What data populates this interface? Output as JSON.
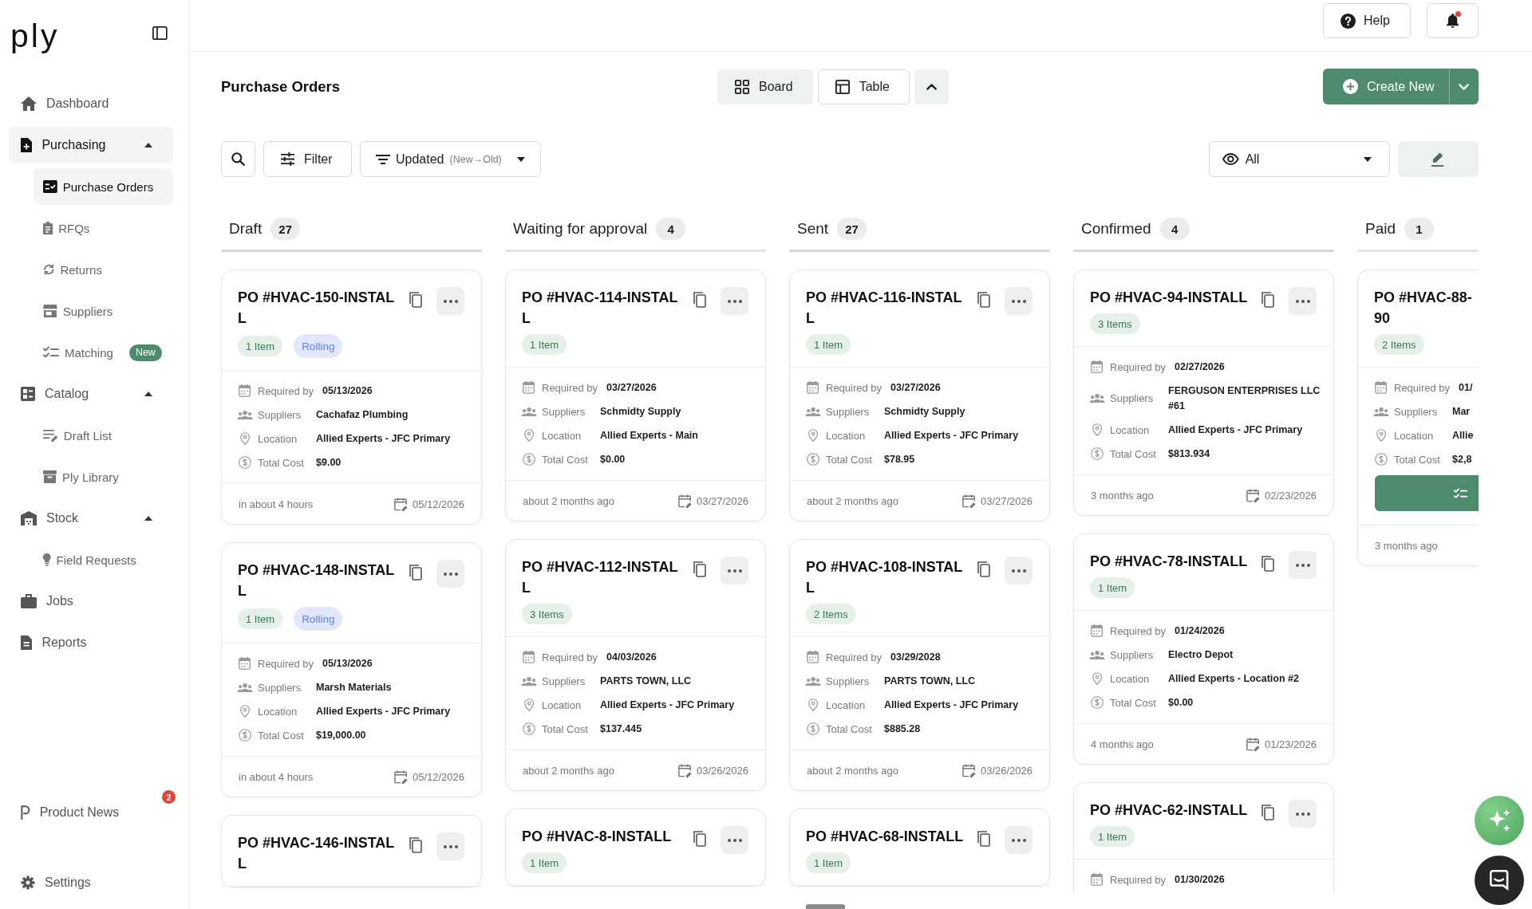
{
  "sidebar": {
    "logo": "ply",
    "items": [
      {
        "label": "Dashboard",
        "selected": false
      },
      {
        "label": "Purchasing",
        "selected": true,
        "expanded": true,
        "children": [
          {
            "label": "Purchase Orders",
            "selected": true
          },
          {
            "label": "RFQs",
            "selected": false
          },
          {
            "label": "Returns",
            "selected": false
          },
          {
            "label": "Suppliers",
            "selected": false
          },
          {
            "label": "Matching",
            "selected": false,
            "badge": {
              "text": "New",
              "kind": "new"
            }
          }
        ]
      },
      {
        "label": "Catalog",
        "selected": false,
        "expanded": true,
        "children": [
          {
            "label": "Draft List",
            "selected": false
          },
          {
            "label": "Ply Library",
            "selected": false
          }
        ]
      },
      {
        "label": "Stock",
        "selected": false,
        "expanded": true,
        "children": [
          {
            "label": "Field Requests",
            "selected": false
          }
        ]
      },
      {
        "label": "Jobs",
        "selected": false
      },
      {
        "label": "Reports",
        "selected": false
      }
    ],
    "footer_items": [
      {
        "label": "Product News",
        "selected": false,
        "badge": {
          "text": "2",
          "kind": "count"
        }
      },
      {
        "label": "Settings",
        "selected": false
      }
    ]
  },
  "topbar": {
    "help": "Help",
    "notifications": {
      "unread": true
    }
  },
  "header": {
    "title": "Purchase Orders",
    "views": [
      {
        "label": "Board",
        "selected": true
      },
      {
        "label": "Table",
        "selected": false
      }
    ],
    "create": "Create New"
  },
  "toolbar": {
    "filter": "Filter",
    "sort": {
      "label": "Updated",
      "order": "(New→Old)"
    },
    "visibility": "All"
  },
  "columns": [
    {
      "title": "Draft",
      "count": "27",
      "color": "#d6d6d6",
      "cards": [
        {
          "title": "PO #HVAC-150-INSTALL",
          "actions": [
            {
              "kind": "copy"
            },
            {
              "kind": "more"
            }
          ],
          "chips": [
            {
              "label": "1 Item",
              "kind": "count"
            },
            {
              "label": "Rolling",
              "kind": "tag"
            }
          ],
          "details": [
            {
              "kind": "required",
              "label": "Required by",
              "value": "05/13/2026"
            },
            {
              "kind": "suppliers",
              "label": "Suppliers",
              "value": "Cachafaz Plumbing"
            },
            {
              "kind": "location",
              "label": "Location",
              "value": "Allied Experts - JFC Primary"
            },
            {
              "kind": "cost",
              "label": "Total Cost",
              "value": "$9.00"
            }
          ],
          "footer": {
            "relative": "in about 4 hours",
            "date": "05/12/2026"
          }
        },
        {
          "title": "PO #HVAC-148-INSTALL",
          "actions": [
            {
              "kind": "copy"
            },
            {
              "kind": "more"
            }
          ],
          "chips": [
            {
              "label": "1 Item",
              "kind": "count"
            },
            {
              "label": "Rolling",
              "kind": "tag"
            }
          ],
          "details": [
            {
              "kind": "required",
              "label": "Required by",
              "value": "05/13/2026"
            },
            {
              "kind": "suppliers",
              "label": "Suppliers",
              "value": "Marsh Materials"
            },
            {
              "kind": "location",
              "label": "Location",
              "value": "Allied Experts - JFC Primary"
            },
            {
              "kind": "cost",
              "label": "Total Cost",
              "value": "$19,000.00"
            }
          ],
          "footer": {
            "relative": "in about 4 hours",
            "date": "05/12/2026"
          }
        },
        {
          "title": "PO #HVAC-146-INSTALL",
          "actions": [
            {
              "kind": "copy"
            },
            {
              "kind": "more"
            }
          ]
        }
      ]
    },
    {
      "title": "Waiting for approval",
      "count": "4",
      "color": "#e2e0f7",
      "cards": [
        {
          "title": "PO #HVAC-114-INSTALL",
          "actions": [
            {
              "kind": "copy"
            },
            {
              "kind": "more"
            }
          ],
          "chips": [
            {
              "label": "1 Item",
              "kind": "count"
            }
          ],
          "details": [
            {
              "kind": "required",
              "label": "Required by",
              "value": "03/27/2026"
            },
            {
              "kind": "suppliers",
              "label": "Suppliers",
              "value": "Schmidty Supply"
            },
            {
              "kind": "location",
              "label": "Location",
              "value": "Allied Experts - Main"
            },
            {
              "kind": "cost",
              "label": "Total Cost",
              "value": "$0.00"
            }
          ],
          "footer": {
            "relative": "about 2 months ago",
            "date": "03/27/2026"
          }
        },
        {
          "title": "PO #HVAC-112-INSTALL",
          "actions": [
            {
              "kind": "copy"
            },
            {
              "kind": "more"
            }
          ],
          "chips": [
            {
              "label": "3 Items",
              "kind": "count"
            }
          ],
          "details": [
            {
              "kind": "required",
              "label": "Required by",
              "value": "04/03/2026"
            },
            {
              "kind": "suppliers",
              "label": "Suppliers",
              "value": "PARTS TOWN, LLC"
            },
            {
              "kind": "location",
              "label": "Location",
              "value": "Allied Experts - JFC Primary"
            },
            {
              "kind": "cost",
              "label": "Total Cost",
              "value": "$137.445"
            }
          ],
          "footer": {
            "relative": "about 2 months ago",
            "date": "03/26/2026"
          }
        },
        {
          "title": "PO #HVAC-8-INSTALL",
          "actions": [
            {
              "kind": "copy"
            },
            {
              "kind": "more"
            }
          ],
          "chips": [
            {
              "label": "1 Item",
              "kind": "count"
            }
          ]
        }
      ]
    },
    {
      "title": "Sent",
      "count": "27",
      "color": "#d6d6d6",
      "cards": [
        {
          "title": "PO #HVAC-116-INSTALL",
          "actions": [
            {
              "kind": "copy"
            },
            {
              "kind": "more"
            }
          ],
          "chips": [
            {
              "label": "1 Item",
              "kind": "count"
            }
          ],
          "details": [
            {
              "kind": "required",
              "label": "Required by",
              "value": "03/27/2026"
            },
            {
              "kind": "suppliers",
              "label": "Suppliers",
              "value": "Schmidty Supply"
            },
            {
              "kind": "location",
              "label": "Location",
              "value": "Allied Experts - JFC Primary"
            },
            {
              "kind": "cost",
              "label": "Total Cost",
              "value": "$78.95"
            }
          ],
          "footer": {
            "relative": "about 2 months ago",
            "date": "03/27/2026"
          }
        },
        {
          "title": "PO #HVAC-108-INSTALL",
          "actions": [
            {
              "kind": "copy"
            },
            {
              "kind": "more"
            }
          ],
          "chips": [
            {
              "label": "2 Items",
              "kind": "count"
            }
          ],
          "details": [
            {
              "kind": "required",
              "label": "Required by",
              "value": "03/29/2028"
            },
            {
              "kind": "suppliers",
              "label": "Suppliers",
              "value": "PARTS TOWN, LLC"
            },
            {
              "kind": "location",
              "label": "Location",
              "value": "Allied Experts - JFC Primary"
            },
            {
              "kind": "cost",
              "label": "Total Cost",
              "value": "$885.28"
            }
          ],
          "footer": {
            "relative": "about 2 months ago",
            "date": "03/26/2026"
          }
        },
        {
          "title": "PO #HVAC-68-INSTALL",
          "actions": [
            {
              "kind": "copy"
            },
            {
              "kind": "more"
            }
          ],
          "chips": [
            {
              "label": "1 Item",
              "kind": "count"
            }
          ]
        }
      ]
    },
    {
      "title": "Confirmed",
      "count": "4",
      "color": "#d6d6d6",
      "cards": [
        {
          "title": "PO #HVAC-94-INSTALL",
          "actions": [
            {
              "kind": "copy"
            },
            {
              "kind": "more"
            }
          ],
          "chips": [
            {
              "label": "3 Items",
              "kind": "count"
            }
          ],
          "details": [
            {
              "kind": "required",
              "label": "Required by",
              "value": "02/27/2026"
            },
            {
              "kind": "suppliers",
              "label": "Suppliers",
              "value": "FERGUSON ENTERPRISES LLC #61"
            },
            {
              "kind": "location",
              "label": "Location",
              "value": "Allied Experts - JFC Primary"
            },
            {
              "kind": "cost",
              "label": "Total Cost",
              "value": "$813.934"
            }
          ],
          "footer": {
            "relative": "3 months ago",
            "date": "02/23/2026"
          }
        },
        {
          "title": "PO #HVAC-78-INSTALL",
          "actions": [
            {
              "kind": "copy"
            },
            {
              "kind": "more"
            }
          ],
          "chips": [
            {
              "label": "1 Item",
              "kind": "count"
            }
          ],
          "details": [
            {
              "kind": "required",
              "label": "Required by",
              "value": "01/24/2026"
            },
            {
              "kind": "suppliers",
              "label": "Suppliers",
              "value": "Electro Depot"
            },
            {
              "kind": "location",
              "label": "Location",
              "value": "Allied Experts - Location #2"
            },
            {
              "kind": "cost",
              "label": "Total Cost",
              "value": "$0.00"
            }
          ],
          "footer": {
            "relative": "4 months ago",
            "date": "01/23/2026"
          }
        },
        {
          "title": "PO #HVAC-62-INSTALL",
          "actions": [
            {
              "kind": "copy"
            },
            {
              "kind": "more"
            }
          ],
          "chips": [
            {
              "label": "1 Item",
              "kind": "count"
            }
          ],
          "details": [
            {
              "kind": "required",
              "label": "Required by",
              "value": "01/30/2026"
            }
          ]
        }
      ]
    },
    {
      "title": "Paid",
      "count": "1",
      "color": "#e2e0f7",
      "cards": [
        {
          "title": "PO #HVAC-88-\n90",
          "chips": [
            {
              "label": "2 Items",
              "kind": "count"
            }
          ],
          "details": [
            {
              "kind": "required",
              "label": "Required by",
              "value": "01/"
            },
            {
              "kind": "suppliers",
              "label": "Suppliers",
              "value": "Mar"
            },
            {
              "kind": "location",
              "label": "Location",
              "value": "Allie"
            },
            {
              "kind": "cost",
              "label": "Total Cost",
              "value": "$2,8"
            }
          ],
          "match_button": true,
          "footer": {
            "relative": "3 months ago"
          }
        }
      ]
    }
  ]
}
